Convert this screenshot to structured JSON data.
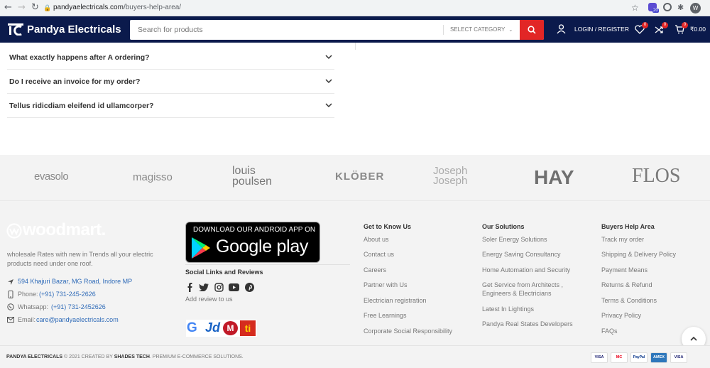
{
  "browser": {
    "url_host": "pandyaelectricals.com",
    "url_path": "/buyers-help-area/",
    "profile_initial": "W",
    "extension_badge": "20"
  },
  "header": {
    "logo_text": "Pandya Electricals",
    "search_placeholder": "Search for products",
    "category_label": "SELECT CATEGORY",
    "login_label": "LOGIN / REGISTER",
    "wishlist_count": "0",
    "compare_count": "0",
    "cart_count": "0",
    "cart_total": "₹0.00"
  },
  "faq": [
    {
      "question": "What exactly happens after A ordering?"
    },
    {
      "question": "Do I receive an invoice for my order?"
    },
    {
      "question": "Tellus ridicdiam eleifend id ullamcorper?"
    }
  ],
  "brands": [
    "evasolo",
    "magisso",
    "louis poulsen",
    "KLÖBER",
    "Joseph Joseph",
    "HAY",
    "FLOS"
  ],
  "footer": {
    "woodmart_logo": "woodmart.",
    "description": "wholesale Rates with new in Trends all your electric products need under one roof.",
    "address": "594 Khajuri Bazar, MG Road, Indore MP",
    "phone_label": "Phone:",
    "phone": "(+91) 731-245-2626",
    "whatsapp_label": "Whatsapp:",
    "whatsapp": "(+91) 731-2452626",
    "email_label": "Email:",
    "email": "care@pandyaelectricals.com",
    "app_line1": "DOWNLOAD OUR ANDROID APP ON",
    "app_line2": "Google play",
    "social_title": "Social Links and Reviews",
    "add_review": "Add review to us",
    "columns": [
      {
        "title": "Get to Know Us",
        "links": [
          "About us",
          "Contact us",
          "Careers",
          "Partner with Us",
          "Electrician registration",
          "Free Learnings",
          "Corporate Social Responsibility"
        ]
      },
      {
        "title": "Our Solutions",
        "links": [
          "Soler Energy Solutions",
          "Energy Saving Consultancy",
          "Home Automation and Security",
          "Get Service from Architects ,",
          "Engineers & Electricians",
          "Latest In Lightings",
          "Pandya Real States Developers"
        ]
      },
      {
        "title": "Buyers Help Area",
        "links": [
          "Track my order",
          "Shipping & Delivery Policy",
          "Payment Means",
          "Returns & Refund",
          "Terms & Conditions",
          "Privacy Policy",
          "FAQs"
        ]
      }
    ]
  },
  "bottom": {
    "brand": "PANDYA ELECTRICALS",
    "copyright": " © 2021 CREATED BY ",
    "creator": "SHADES TECH",
    "tail": ". PREMIUM E-COMMERCE SOLUTIONS.",
    "cards": [
      "VISA",
      "MC",
      "PayPal",
      "AMEX",
      "VISA"
    ]
  }
}
